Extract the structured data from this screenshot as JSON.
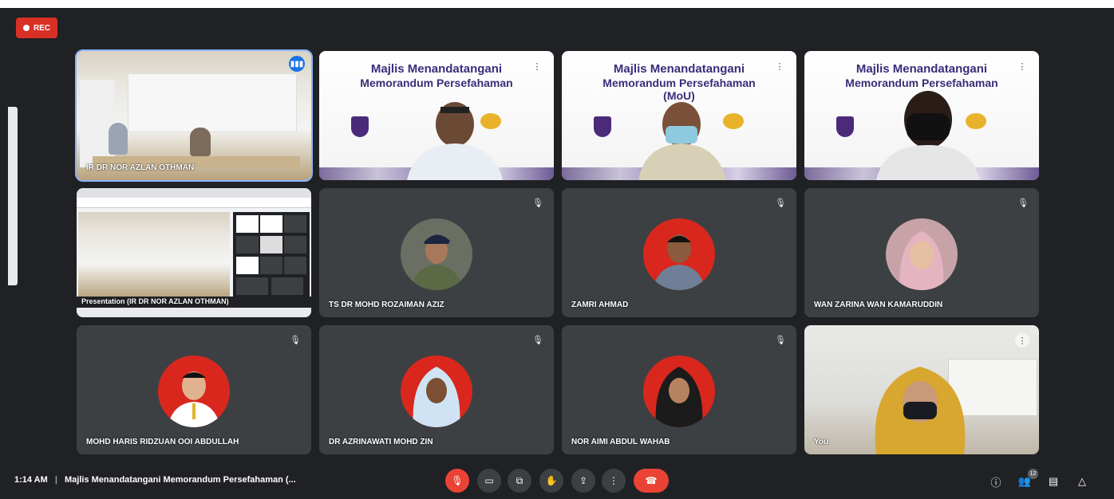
{
  "recording": {
    "label": "REC"
  },
  "tiles": [
    {
      "name": "IR DR NOR AZLAN OTHMAN",
      "kind": "camera-room",
      "speaking": true
    },
    {
      "title1": "Majlis Menandatangani",
      "title2": "Memorandum Persefahaman",
      "kind": "banner-cam"
    },
    {
      "title1": "Majlis Menandatangani",
      "title2": "Memorandum Persefahaman",
      "title3": "(MoU)",
      "kind": "banner-cam"
    },
    {
      "title1": "Majlis Menandatangani",
      "title2": "Memorandum Persefahaman",
      "kind": "banner-cam"
    },
    {
      "name": "Presentation (IR DR NOR AZLAN OTHMAN)",
      "kind": "presentation"
    },
    {
      "name": "TS DR MOHD ROZAIMAN AZIZ",
      "kind": "avatar",
      "muted": true
    },
    {
      "name": "ZAMRI AHMAD",
      "kind": "avatar",
      "muted": true
    },
    {
      "name": "WAN ZARINA WAN KAMARUDDIN",
      "kind": "avatar",
      "muted": true
    },
    {
      "name": "MOHD HARIS RIDZUAN OOI ABDULLAH",
      "kind": "avatar",
      "muted": true
    },
    {
      "name": "DR AZRINAWATI MOHD ZIN",
      "kind": "avatar",
      "muted": true
    },
    {
      "name": "NOR AIMI ABDUL WAHAB",
      "kind": "avatar",
      "muted": true
    },
    {
      "name": "You",
      "kind": "camera-self"
    }
  ],
  "toolbar": {
    "time": "1:14 AM",
    "meeting_title": "Majlis Menandatangani Memorandum Persefahaman (...",
    "participants_count": "12",
    "buttons": [
      "mic-off",
      "camera",
      "captions",
      "raise-hand",
      "present",
      "more",
      "leave-call"
    ],
    "right_icons": [
      "info",
      "people",
      "chat",
      "activities"
    ]
  },
  "colors": {
    "background": "#202124",
    "tile": "#3c4043",
    "danger": "#ea4335",
    "accent": "#8ab4f8"
  }
}
